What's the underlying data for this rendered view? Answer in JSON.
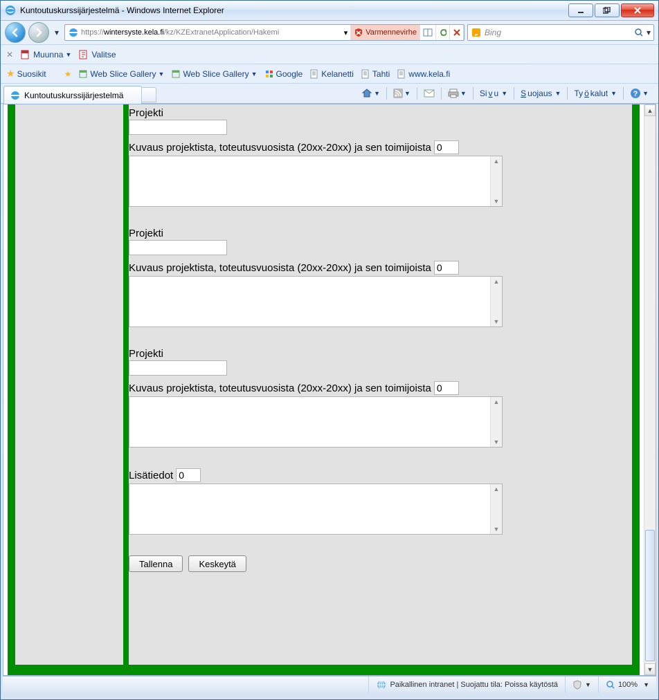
{
  "window": {
    "title": "Kuntoutuskurssijärjestelmä - Windows Internet Explorer"
  },
  "nav": {
    "url_prefix": "https://",
    "url_host": "wintersyste.kela.fi",
    "url_path": "/kz/KZExtranetApplication/Hakemi",
    "cert_error": "Varmennevirhe",
    "search_placeholder": "Bing"
  },
  "toolbar1": {
    "muunna": "Muunna",
    "valitse": "Valitse"
  },
  "favbar": {
    "suosikit": "Suosikit",
    "item1": "Web Slice Gallery",
    "item2": "Web Slice Gallery",
    "item3": "Google",
    "item4": "Kelanetti",
    "item5": "Tahti",
    "item6": "www.kela.fi"
  },
  "tab": {
    "title": "Kuntoutuskurssijärjestelmä"
  },
  "cmd": {
    "page": "Sivu",
    "security": "Suojaus",
    "tools": "Työkalut"
  },
  "form": {
    "projekti_label": "Projekti",
    "desc_label": "Kuvaus projektista, toteutusvuosista (20xx-20xx) ja sen toimijoista",
    "counter": "0",
    "lisatiedot_label": "Lisätiedot",
    "lisatiedot_counter": "0",
    "save": "Tallenna",
    "cancel": "Keskeytä"
  },
  "status": {
    "zone": "Paikallinen intranet | Suojattu tila: Poissa käytöstä",
    "zoom": "100%"
  }
}
